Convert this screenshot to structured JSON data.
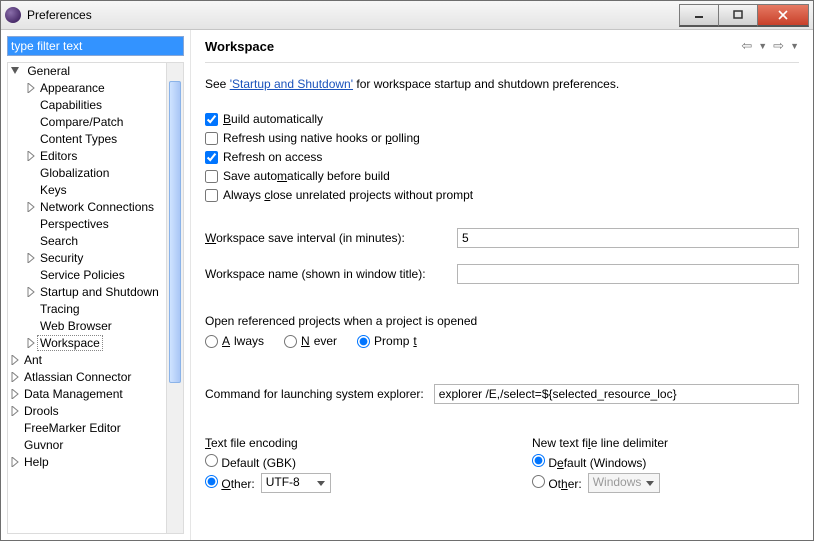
{
  "window": {
    "title": "Preferences"
  },
  "filter": {
    "placeholder": "type filter text"
  },
  "tree": {
    "general": "General",
    "items": {
      "appearance": "Appearance",
      "capabilities": "Capabilities",
      "compare": "Compare/Patch",
      "contenttypes": "Content Types",
      "editors": "Editors",
      "globalization": "Globalization",
      "keys": "Keys",
      "network": "Network Connections",
      "perspectives": "Perspectives",
      "search": "Search",
      "security": "Security",
      "servicepolicies": "Service Policies",
      "startup": "Startup and Shutdown",
      "tracing": "Tracing",
      "webbrowser": "Web Browser",
      "workspace": "Workspace"
    },
    "ant": "Ant",
    "atlassian": "Atlassian Connector",
    "datamgmt": "Data Management",
    "drools": "Drools",
    "freemarker": "FreeMarker Editor",
    "guvnor": "Guvnor",
    "help": "Help"
  },
  "page": {
    "title": "Workspace",
    "see_pre": "See ",
    "see_link": "'Startup and Shutdown'",
    "see_post": " for workspace startup and shutdown preferences.",
    "chk_build": "Build automatically",
    "chk_refresh_hooks": "Refresh using native hooks or polling",
    "chk_refresh_access": "Refresh on access",
    "chk_save_before": "Save automatically before build",
    "chk_close_unrelated": "Always close unrelated projects without prompt",
    "save_interval_label": "Workspace save interval (in minutes):",
    "save_interval_value": "5",
    "ws_name_label": "Workspace name (shown in window title):",
    "ws_name_value": "",
    "open_ref_label": "Open referenced projects when a project is opened",
    "radio_always": "Always",
    "radio_never": "Never",
    "radio_prompt": "Prompt",
    "explorer_label": "Command for launching system explorer:",
    "explorer_value": "explorer /E,/select=${selected_resource_loc}",
    "enc_header": "Text file encoding",
    "enc_default": "Default (GBK)",
    "enc_other": "Other:",
    "enc_value": "UTF-8",
    "nl_header": "New text file line delimiter",
    "nl_default": "Default (Windows)",
    "nl_other": "Other:",
    "nl_value": "Windows"
  }
}
